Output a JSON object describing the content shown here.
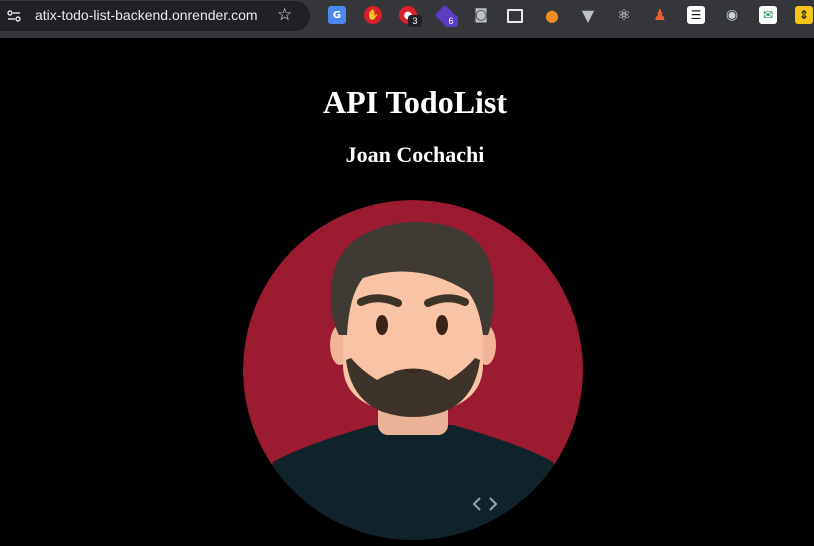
{
  "browser": {
    "url": "atix-todo-list-backend.onrender.com",
    "extension_badges": [
      "3",
      "6"
    ],
    "icons": [
      "site-info-icon",
      "bookmark-star-icon",
      "google-translate-icon",
      "adblock-icon",
      "extension-red-icon",
      "extension-purple-icon",
      "camera-icon",
      "picture-in-picture-icon",
      "extension-orange-icon",
      "vue-devtools-icon",
      "react-devtools-icon",
      "extension-figure-icon",
      "list-icon",
      "glasses-icon",
      "mail-icon",
      "arrows-icon"
    ]
  },
  "page": {
    "title": "API TodoList",
    "author": "Joan Cochachi"
  },
  "colors": {
    "background": "#000000",
    "avatar_circle": "#9b1b30",
    "hair": "#3f3a33",
    "skin": "#f9c3a6",
    "beard": "#3d3329",
    "shirt": "#10232a"
  }
}
